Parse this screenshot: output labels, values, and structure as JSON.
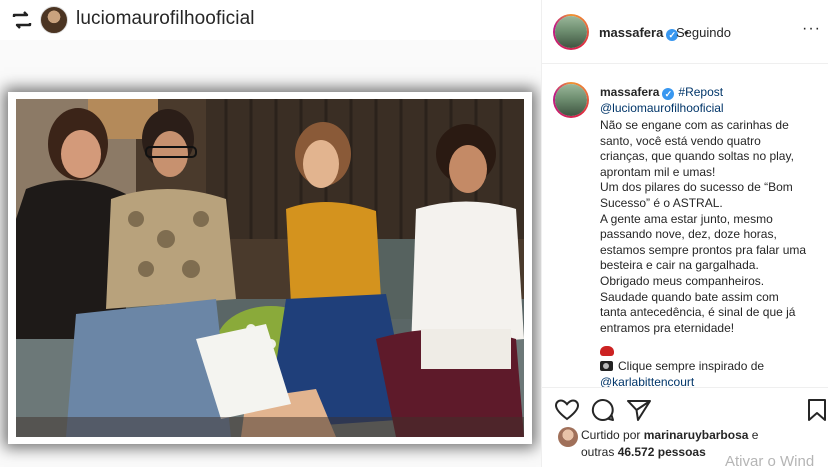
{
  "repost": {
    "username": "luciomaurofilhooficial"
  },
  "header": {
    "username": "massafera",
    "separator": "•",
    "follow_status": "Seguindo",
    "more": "···"
  },
  "caption": {
    "username": "massafera",
    "hashtag": "#Repost",
    "mention": "@luciomaurofilhooficial",
    "lines": [
      "Não se engane com as carinhas de",
      "santo, você está vendo quatro",
      "crianças, que quando soltas no play,",
      "aprontam mil e umas!",
      "Um dos pilares do sucesso de “Bom",
      "Sucesso” é o ASTRAL.",
      "A gente ama estar junto, mesmo",
      "passando nove, dez, doze horas,",
      "estamos sempre prontos pra falar uma",
      "besteira e cair na gargalhada.",
      "Obrigado meus companheiros.",
      "Saudade quando bate assim com",
      "tanta antecedência, é sinal de que já",
      "entramos pra eternidade!"
    ],
    "credit_text": "Clique sempre inspirado de",
    "credit_mention": "@karlabittencourt"
  },
  "likes": {
    "prefix": "Curtido por",
    "user": "marinaruybarbosa",
    "conjunction": "e",
    "others_prefix": "outras",
    "others_count": "46.572 pessoas"
  },
  "icons": [
    "repost-icon",
    "heart-icon",
    "comment-icon",
    "share-icon",
    "bookmark-icon",
    "verified-icon",
    "glove-icon",
    "camera-icon"
  ],
  "watermark": "Ativar o Wind",
  "colors": {
    "verified": "#3897f0",
    "link": "#003569",
    "text": "#262626",
    "border": "#efefef"
  }
}
